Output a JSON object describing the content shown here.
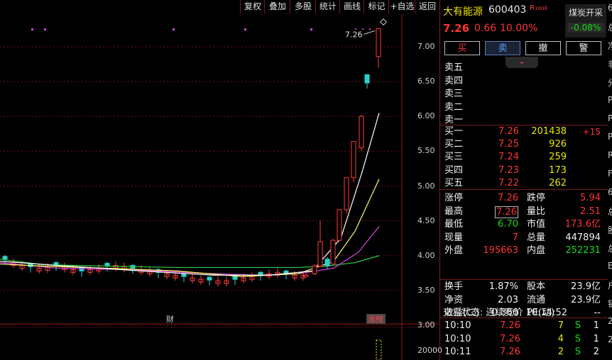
{
  "toolbar": {
    "items": [
      "复权",
      "叠加",
      "多股",
      "统计",
      "画线",
      "标记",
      "+自选",
      "返回"
    ]
  },
  "chart": {
    "price_ticks": [
      "7.00",
      "6.50",
      "6.00",
      "5.50",
      "5.00",
      "4.50",
      "4.00",
      "3.50",
      "3.00"
    ],
    "volume_tick": "20000",
    "high_annotation": "7.26",
    "marker_cai": "财",
    "marker_zhangbang": "涨榜"
  },
  "chart_data": {
    "type": "candlestick",
    "price_axis": {
      "ticks": [
        7.0,
        6.5,
        6.0,
        5.5,
        5.0,
        4.5,
        4.0,
        3.5,
        3.0
      ]
    },
    "high_label": 7.26,
    "recent_candles": [
      {
        "open": 3.72,
        "close": 3.72,
        "high": 3.76,
        "low": 3.7
      },
      {
        "open": 3.74,
        "close": 3.85,
        "high": 3.88,
        "low": 3.72
      },
      {
        "open": 3.85,
        "close": 4.2,
        "high": 4.5,
        "low": 3.84
      },
      {
        "open": 3.95,
        "close": 3.85,
        "high": 3.98,
        "low": 3.8
      },
      {
        "open": 3.88,
        "close": 4.22,
        "high": 4.24,
        "low": 3.87
      },
      {
        "open": 4.22,
        "close": 4.66,
        "high": 4.66,
        "low": 4.2
      },
      {
        "open": 4.66,
        "close": 5.12,
        "high": 5.12,
        "low": 4.6
      },
      {
        "open": 5.12,
        "close": 5.64,
        "high": 5.64,
        "low": 5.05
      },
      {
        "open": 5.55,
        "close": 6.0,
        "high": 6.02,
        "low": 5.5
      },
      {
        "open": 6.6,
        "close": 6.48,
        "high": 6.6,
        "low": 6.4
      },
      {
        "open": 6.86,
        "close": 7.26,
        "high": 7.26,
        "low": 6.7
      }
    ]
  },
  "quote": {
    "name": "大有能源",
    "code": "600403",
    "badge": "R",
    "badge_sub": "1000",
    "sector": "煤炭开采",
    "sector_change": "-0.08%",
    "price": "7.26",
    "change": "0.66",
    "pct": "10.00%"
  },
  "actions": [
    "买",
    "卖",
    "撤",
    "警"
  ],
  "expand_glyph": "⌄",
  "sells": [
    {
      "label": "卖五"
    },
    {
      "label": "卖四"
    },
    {
      "label": "卖三"
    },
    {
      "label": "卖二"
    },
    {
      "label": "卖一"
    }
  ],
  "buys": [
    {
      "label": "买一",
      "price": "7.26",
      "vol": "201438",
      "delta": "+15"
    },
    {
      "label": "买二",
      "price": "7.25",
      "vol": "926",
      "delta": ""
    },
    {
      "label": "买三",
      "price": "7.24",
      "vol": "259",
      "delta": ""
    },
    {
      "label": "买四",
      "price": "7.23",
      "vol": "173",
      "delta": ""
    },
    {
      "label": "买五",
      "price": "7.22",
      "vol": "262",
      "delta": ""
    }
  ],
  "stats1": [
    {
      "l1": "涨停",
      "v1": "7.26",
      "l2": "跌停",
      "v2": "5.94"
    },
    {
      "l1": "最高",
      "v1": "7.26",
      "l2": "量比",
      "v2": "2.51"
    },
    {
      "l1": "最低",
      "v1": "6.70",
      "l2": "市值",
      "v2": "173.6亿"
    },
    {
      "l1": "现量",
      "v1": "7",
      "l2": "总量",
      "v2": "447894"
    },
    {
      "l1": "外盘",
      "v1": "195663",
      "l2": "内盘",
      "v2": "252231"
    }
  ],
  "stats2": [
    {
      "l1": "换手",
      "v1": "1.87%",
      "l2": "股本",
      "v2": "23.9亿"
    },
    {
      "l1": "净资",
      "v1": "2.03",
      "l2": "流通",
      "v2": "23.9亿"
    },
    {
      "l1": "收益(二)",
      "v1": "-0.360",
      "l2": "PE(动)",
      "v2": "--"
    }
  ],
  "trade_status": "交易状态: 连续竞价 10:14:52",
  "ticks": [
    {
      "time": "10:10",
      "price": "7.26",
      "vol": "7",
      "side": "S",
      "n": "1"
    },
    {
      "time": "10:10",
      "price": "7.26",
      "vol": "4",
      "side": "S",
      "n": "1"
    },
    {
      "time": "10:11",
      "price": "7.26",
      "vol": "2",
      "side": "S",
      "n": "2"
    }
  ],
  "edge_text": [
    "6",
    "总",
    "净",
    "非",
    "分",
    "P",
    "P",
    "P",
    "R",
    "F",
    "6",
    "总",
    "股",
    "总",
    "E",
    "户",
    "销",
    "2",
    "2"
  ]
}
